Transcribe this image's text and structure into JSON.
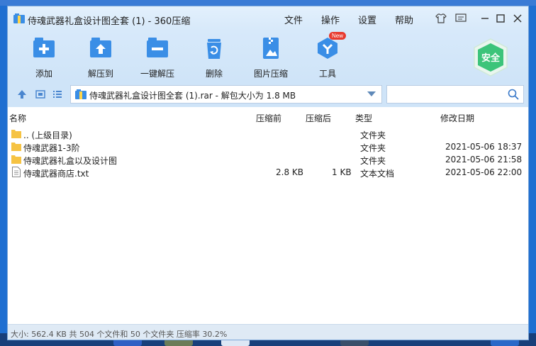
{
  "window": {
    "title": "侍魂武器礼盒设计图全套 (1) - 360压缩",
    "menu": [
      "文件",
      "操作",
      "设置",
      "帮助"
    ]
  },
  "toolbar": {
    "items": [
      {
        "label": "添加",
        "icon": "add-icon"
      },
      {
        "label": "解压到",
        "icon": "extract-to-icon"
      },
      {
        "label": "一键解压",
        "icon": "one-click-extract-icon"
      },
      {
        "label": "删除",
        "icon": "delete-icon"
      },
      {
        "label": "图片压缩",
        "icon": "image-compress-icon"
      },
      {
        "label": "工具",
        "icon": "tools-icon"
      }
    ],
    "new_badge": "New",
    "safe_label": "安全"
  },
  "address": {
    "path": "侍魂武器礼盒设计图全套 (1).rar - 解包大小为 1.8 MB",
    "search_placeholder": ""
  },
  "columns": {
    "name": "名称",
    "before": "压缩前",
    "after": "压缩后",
    "type": "类型",
    "date": "修改日期"
  },
  "files": [
    {
      "name": ".. (上级目录)",
      "before": "",
      "after": "",
      "type": "文件夹",
      "date": "",
      "kind": "folder"
    },
    {
      "name": "侍魂武器1-3阶",
      "before": "",
      "after": "",
      "type": "文件夹",
      "date": "2021-05-06 18:37",
      "kind": "folder"
    },
    {
      "name": "侍魂武器礼盒以及设计图",
      "before": "",
      "after": "",
      "type": "文件夹",
      "date": "2021-05-06 21:58",
      "kind": "folder"
    },
    {
      "name": "侍魂武器商店.txt",
      "before": "2.8 KB",
      "after": "1 KB",
      "type": "文本文档",
      "date": "2021-05-06 22:00",
      "kind": "txt"
    }
  ],
  "status": "大小: 562.4 KB 共 504 个文件和 50 个文件夹 压缩率 30.2%",
  "colors": {
    "accent": "#3a8ee6",
    "titlebar": "#dcecfb",
    "safe_green": "#3cc47a",
    "folder": "#f6c343"
  }
}
